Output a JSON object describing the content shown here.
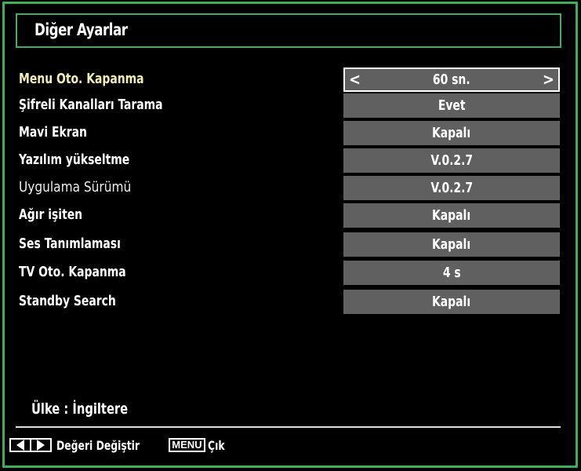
{
  "header": {
    "title": "Diğer Ayarlar"
  },
  "settings": [
    {
      "label": "Menu Oto. Kapanma",
      "value": "60 sn.",
      "selected": true
    },
    {
      "label": "Şifreli Kanalları Tarama",
      "value": "Evet"
    },
    {
      "label": "Mavi Ekran",
      "value": "Kapalı"
    },
    {
      "label": "Yazılım yükseltme",
      "value": "V.0.2.7"
    },
    {
      "label": "Uygulama Sürümü",
      "value": "V.0.2.7"
    },
    {
      "label": "Ağır işiten",
      "value": "Kapalı"
    },
    {
      "label": "Ses Tanımlaması",
      "value": "Kapalı"
    },
    {
      "label": "TV Oto. Kapanma",
      "value": "4 s"
    },
    {
      "label": "Standby Search",
      "value": "Kapalı"
    }
  ],
  "selector": {
    "left_arrow": "<",
    "right_arrow": ">"
  },
  "status": {
    "country": "Ülke : İngiltere"
  },
  "footer": {
    "change_value_label": "Değeri Değiştir",
    "menu_key": "MENU",
    "exit_label": "Çık"
  },
  "colors": {
    "border_accent": "#3fae5a",
    "value_bg": "#606060",
    "selected_label": "#f5efb5"
  }
}
